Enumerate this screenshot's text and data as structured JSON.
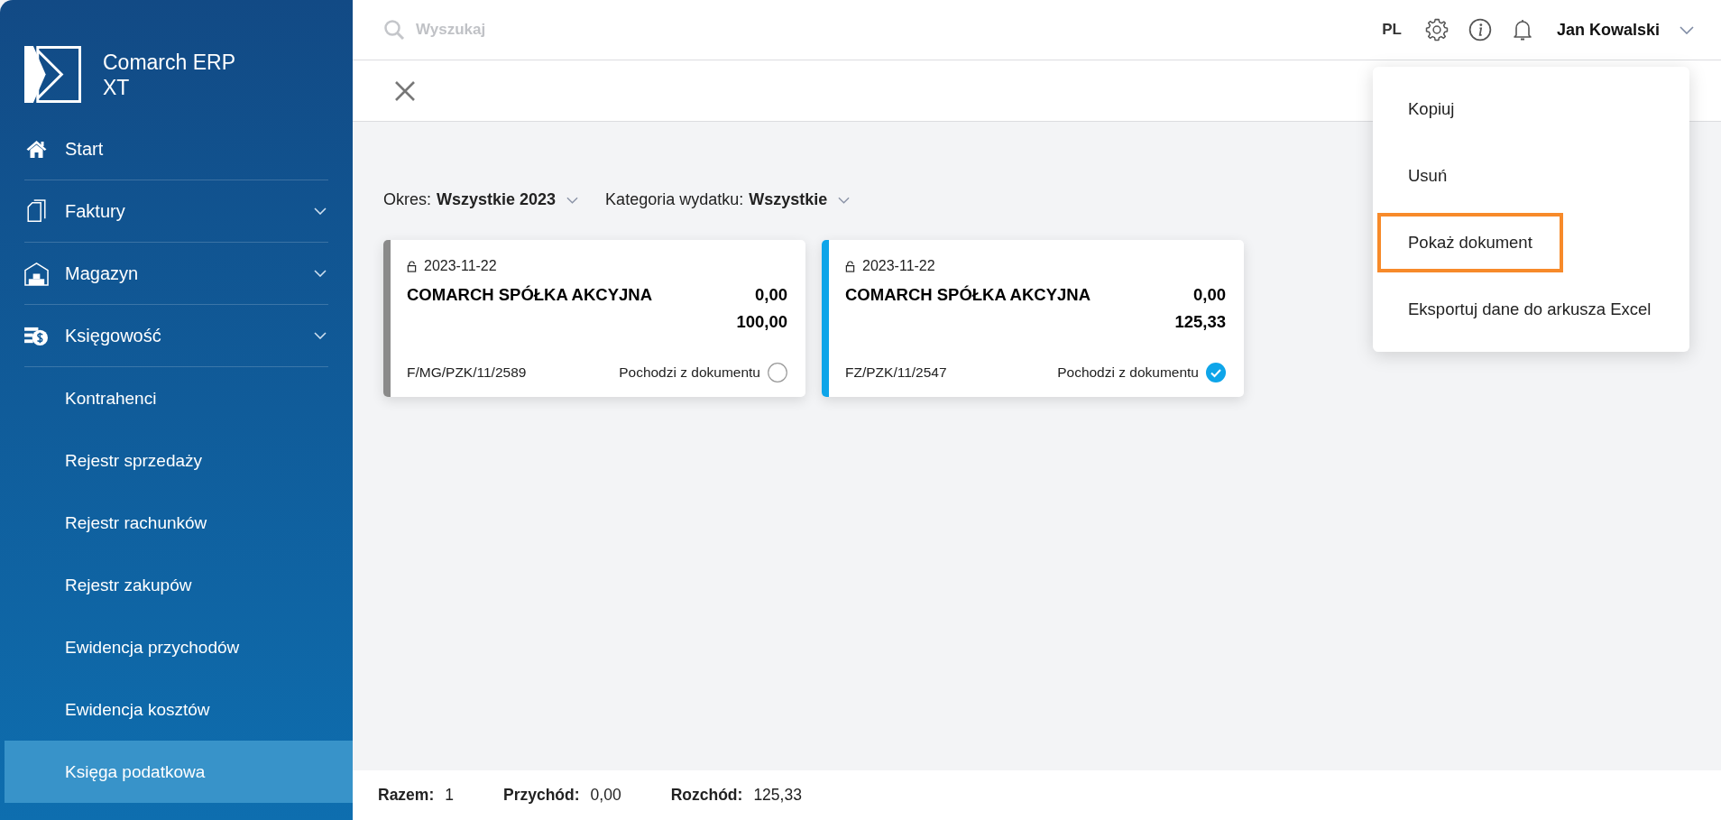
{
  "app": {
    "name_line1": "Comarch ERP",
    "name_line2": "XT"
  },
  "sidebar": {
    "items": [
      {
        "label": "Start",
        "expandable": false,
        "selected": false
      },
      {
        "label": "Faktury",
        "expandable": true,
        "selected": false
      },
      {
        "label": "Magazyn",
        "expandable": true,
        "selected": false
      },
      {
        "label": "Księgowość",
        "expandable": true,
        "selected": false,
        "children": [
          {
            "label": "Kontrahenci",
            "selected": false
          },
          {
            "label": "Rejestr sprzedaży",
            "selected": false
          },
          {
            "label": "Rejestr rachunków",
            "selected": false
          },
          {
            "label": "Rejestr zakupów",
            "selected": false
          },
          {
            "label": "Ewidencja przychodów",
            "selected": false
          },
          {
            "label": "Ewidencja kosztów",
            "selected": false
          },
          {
            "label": "Księga podatkowa",
            "selected": true
          }
        ]
      }
    ]
  },
  "topbar": {
    "search_placeholder": "Wyszukaj",
    "language": "PL",
    "user": "Jan Kowalski"
  },
  "filters": [
    {
      "label": "Okres:",
      "value": "Wszystkie 2023"
    },
    {
      "label": "Kategoria wydatku:",
      "value": "Wszystkie"
    }
  ],
  "cards": [
    {
      "date": "2023-11-22",
      "company": "COMARCH SPÓŁKA AKCYJNA",
      "amount_1": "0,00",
      "amount_2": "100,00",
      "number": "F/MG/PZK/11/2589",
      "source_label": "Pochodzi z dokumentu",
      "checked": false,
      "color": "#8a8a8a"
    },
    {
      "date": "2023-11-22",
      "company": "COMARCH SPÓŁKA AKCYJNA",
      "amount_1": "0,00",
      "amount_2": "125,33",
      "number": "FZ/PZK/11/2547",
      "source_label": "Pochodzi z dokumentu",
      "checked": true,
      "color": "#0ea5e9"
    }
  ],
  "context_menu": {
    "items": [
      {
        "label": "Kopiuj",
        "selected": false
      },
      {
        "label": "Usuń",
        "selected": false
      },
      {
        "label": "Pokaż dokument",
        "selected": true
      },
      {
        "label": "Eksportuj dane do arkusza Excel",
        "selected": false
      }
    ]
  },
  "status_bar": [
    {
      "label": "Razem:",
      "value": "1"
    },
    {
      "label": "Przychód:",
      "value": "0,00"
    },
    {
      "label": "Rozchód:",
      "value": "125,33"
    }
  ]
}
